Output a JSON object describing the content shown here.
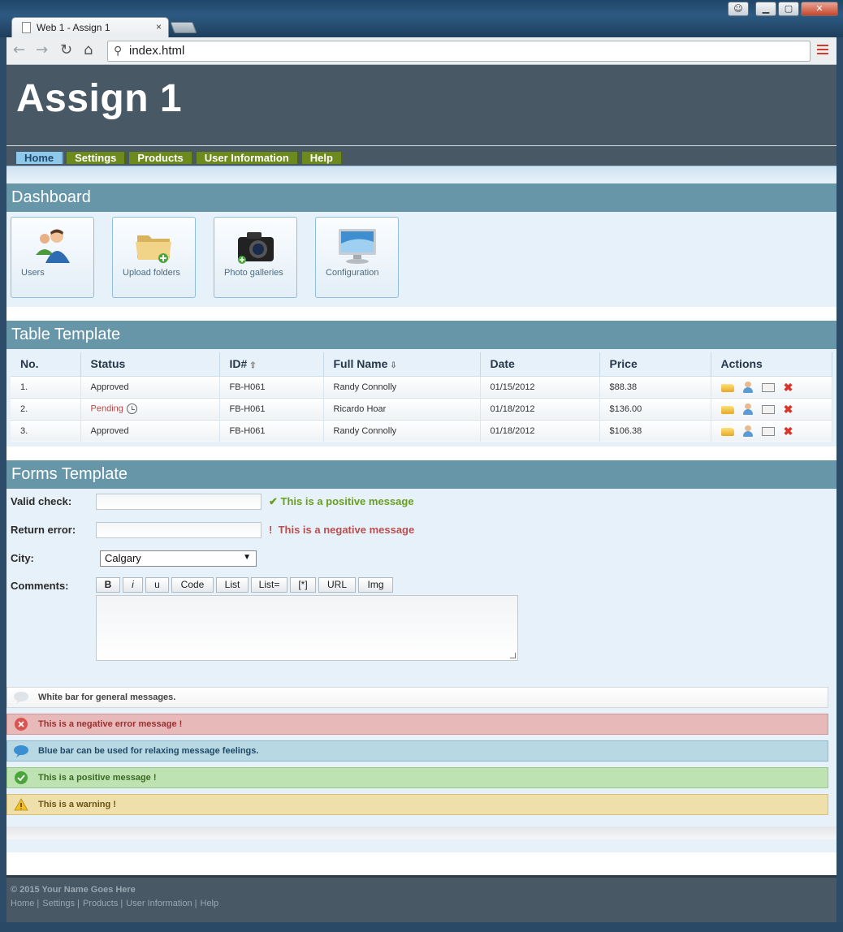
{
  "browser": {
    "tab_title": "Web 1 - Assign 1",
    "tab_close": "×",
    "address": "index.html",
    "back_glyph": "←",
    "forward_glyph": "→",
    "reload_glyph": "↻",
    "home_glyph": "⌂",
    "min_glyph": "▁",
    "max_glyph": "▢",
    "close_glyph": "✕"
  },
  "site": {
    "title": "Assign 1",
    "nav": [
      {
        "label": "Home",
        "active": true
      },
      {
        "label": "Settings"
      },
      {
        "label": "Products"
      },
      {
        "label": "User Information"
      },
      {
        "label": "Help"
      }
    ]
  },
  "dashboard": {
    "heading": "Dashboard",
    "tiles": [
      {
        "label": "Users",
        "icon": "users-icon"
      },
      {
        "label": "Upload folders",
        "icon": "folder-add-icon"
      },
      {
        "label": "Photo galleries",
        "icon": "camera-icon"
      },
      {
        "label": "Configuration",
        "icon": "monitor-icon"
      }
    ]
  },
  "table": {
    "heading": "Table Template",
    "columns": [
      "No.",
      "Status",
      "ID#",
      "Full Name",
      "Date",
      "Price",
      "Actions"
    ],
    "sort_up": "⇧",
    "sort_down": "⇩",
    "rows": [
      {
        "no": "1.",
        "status": "Approved",
        "id": "FB-H061",
        "name": "Randy Connolly",
        "date": "01/15/2012",
        "price": "$88.38"
      },
      {
        "no": "2.",
        "status": "Pending",
        "id": "FB-H061",
        "name": "Ricardo Hoar",
        "date": "01/18/2012",
        "price": "$136.00"
      },
      {
        "no": "3.",
        "status": "Approved",
        "id": "FB-H061",
        "name": "Randy Connolly",
        "date": "01/18/2012",
        "price": "$106.38"
      }
    ],
    "delete_glyph": "✖"
  },
  "forms": {
    "heading": "Forms Template",
    "valid_label": "Valid check:",
    "valid_msg": "This is a positive message",
    "valid_glyph": "✔",
    "error_label": "Return error:",
    "error_msg": "This is a negative message",
    "error_glyph": "!",
    "city_label": "City:",
    "city_value": "Calgary",
    "caret": "▼",
    "comments_label": "Comments:",
    "editor_buttons": [
      "B",
      "i",
      "u",
      "Code",
      "List",
      "List=",
      "[*]",
      "URL",
      "Img"
    ]
  },
  "alerts": {
    "general": "White bar for general messages.",
    "error": "This is a negative error message !",
    "info": "Blue bar can be used for relaxing message feelings.",
    "success": "This is a positive message !",
    "warning": "This is a warning !",
    "error_glyph": "✕",
    "success_glyph": "✔",
    "warning_glyph": "!"
  },
  "footer": {
    "copyright": "© 2015 Your Name Goes Here",
    "links": [
      "Home |",
      "Settings |",
      "Products |",
      "User Information |",
      "Help"
    ]
  },
  "colors": {
    "header_bg": "#485864",
    "section_bar": "#6796a8",
    "nav_green": "#6d8a1d",
    "nav_active": "#8ec8ea",
    "positive": "#6a9e22",
    "negative": "#b85050"
  }
}
